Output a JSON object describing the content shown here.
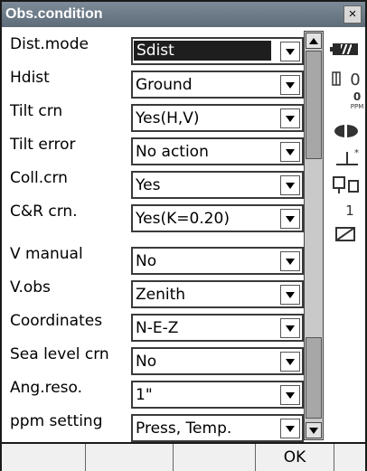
{
  "window": {
    "title": "Obs.condition",
    "close_label": "×"
  },
  "rows": [
    {
      "label": "Dist.mode",
      "value": "Sdist",
      "selected": true
    },
    {
      "label": "Hdist",
      "value": "Ground"
    },
    {
      "label": "Tilt crn",
      "value": "Yes(H,V)"
    },
    {
      "label": "Tilt error",
      "value": "No action"
    },
    {
      "label": "Coll.crn",
      "value": "Yes"
    },
    {
      "label": "C&R crn.",
      "value": "Yes(K=0.20)"
    },
    {
      "label": "V manual",
      "value": "No"
    },
    {
      "label": "V.obs",
      "value": "Zenith"
    },
    {
      "label": "Coordinates",
      "value": "N-E-Z"
    },
    {
      "label": "Sea level crn",
      "value": "No"
    },
    {
      "label": "Ang.reso.",
      "value": "1\""
    },
    {
      "label": "ppm setting",
      "value": "Press, Temp."
    }
  ],
  "status": {
    "battery_icon": "battery-icon",
    "target_value": "0",
    "ppm_value": "0",
    "ppm_unit": "PPM",
    "mode_value": "1"
  },
  "softkeys": [
    "",
    "",
    "",
    "OK",
    ""
  ]
}
